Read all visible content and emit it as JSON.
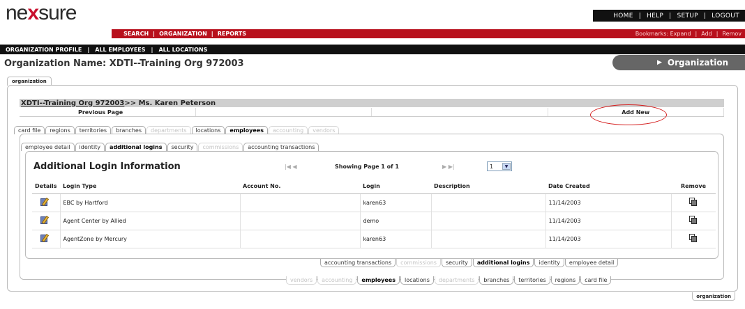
{
  "logo": {
    "pre": "ne",
    "x": "x",
    "post": "sure"
  },
  "top_nav": [
    "HOME",
    "|",
    "HELP",
    "|",
    "SETUP",
    "|",
    "LOGOUT"
  ],
  "red_nav": {
    "left": [
      "SEARCH",
      "|",
      "ORGANIZATION",
      "|",
      "REPORTS"
    ],
    "right": [
      "Bookmarks: Expand",
      "|",
      "Add",
      "|",
      "Remov"
    ]
  },
  "black_nav": [
    "ORGANIZATION PROFILE",
    "|",
    "ALL EMPLOYEES",
    "|",
    "ALL LOCATIONS"
  ],
  "page": {
    "org_name": "Organization Name: XDTI--Training Org 972003",
    "section_pill": "Organization",
    "org_tab": "organization",
    "org_tab_bottom": "organization"
  },
  "breadcrumb": {
    "org_link": "XDTI--Training Org 972003",
    "rest": " >> Ms. Karen Peterson"
  },
  "actions": {
    "previous": "Previous Page",
    "add_new": "Add New"
  },
  "main_tabs": [
    {
      "label": "card file",
      "state": "normal"
    },
    {
      "label": "regions",
      "state": "normal"
    },
    {
      "label": "territories",
      "state": "normal"
    },
    {
      "label": "branches",
      "state": "normal"
    },
    {
      "label": "departments",
      "state": "disabled"
    },
    {
      "label": "locations",
      "state": "normal"
    },
    {
      "label": "employees",
      "state": "active"
    },
    {
      "label": "accounting",
      "state": "disabled"
    },
    {
      "label": "vendors",
      "state": "disabled"
    }
  ],
  "sub_tabs": [
    {
      "label": "employee detail",
      "state": "normal"
    },
    {
      "label": "identity",
      "state": "normal"
    },
    {
      "label": "additional logins",
      "state": "active"
    },
    {
      "label": "security",
      "state": "normal"
    },
    {
      "label": "commissions",
      "state": "disabled"
    },
    {
      "label": "accounting transactions",
      "state": "normal"
    }
  ],
  "section": {
    "title": "Additional Login Information",
    "pager_first": "|◀ ◀",
    "pager_last": "▶ ▶|",
    "pager_info": "Showing Page 1 of 1",
    "page_value": "1"
  },
  "table": {
    "headers": [
      "Details",
      "Login Type",
      "Account No.",
      "Login",
      "Description",
      "Date Created",
      "Remove"
    ],
    "rows": [
      {
        "login_type": "EBC by Hartford",
        "account_no": "",
        "login": "karen63",
        "description": "",
        "date_created": "11/14/2003"
      },
      {
        "login_type": "Agent Center by Allied",
        "account_no": "",
        "login": "demo",
        "description": "",
        "date_created": "11/14/2003"
      },
      {
        "login_type": "AgentZone by Mercury",
        "account_no": "",
        "login": "karen63",
        "description": "",
        "date_created": "11/14/2003"
      }
    ]
  },
  "bottom_sub_tabs": [
    {
      "label": "accounting transactions",
      "state": "normal"
    },
    {
      "label": "commissions",
      "state": "disabled"
    },
    {
      "label": "security",
      "state": "normal"
    },
    {
      "label": "additional logins",
      "state": "active"
    },
    {
      "label": "identity",
      "state": "normal"
    },
    {
      "label": "employee detail",
      "state": "normal"
    }
  ],
  "bottom_main_tabs": [
    {
      "label": "vendors",
      "state": "disabled"
    },
    {
      "label": "accounting",
      "state": "disabled"
    },
    {
      "label": "employees",
      "state": "active"
    },
    {
      "label": "locations",
      "state": "normal"
    },
    {
      "label": "departments",
      "state": "disabled"
    },
    {
      "label": "branches",
      "state": "normal"
    },
    {
      "label": "territories",
      "state": "normal"
    },
    {
      "label": "regions",
      "state": "normal"
    },
    {
      "label": "card file",
      "state": "normal"
    }
  ],
  "colors": {
    "brand_red": "#b8101c",
    "annotation_red": "#d41c1c",
    "nav_black": "#111111",
    "pill_gray": "#666666"
  }
}
